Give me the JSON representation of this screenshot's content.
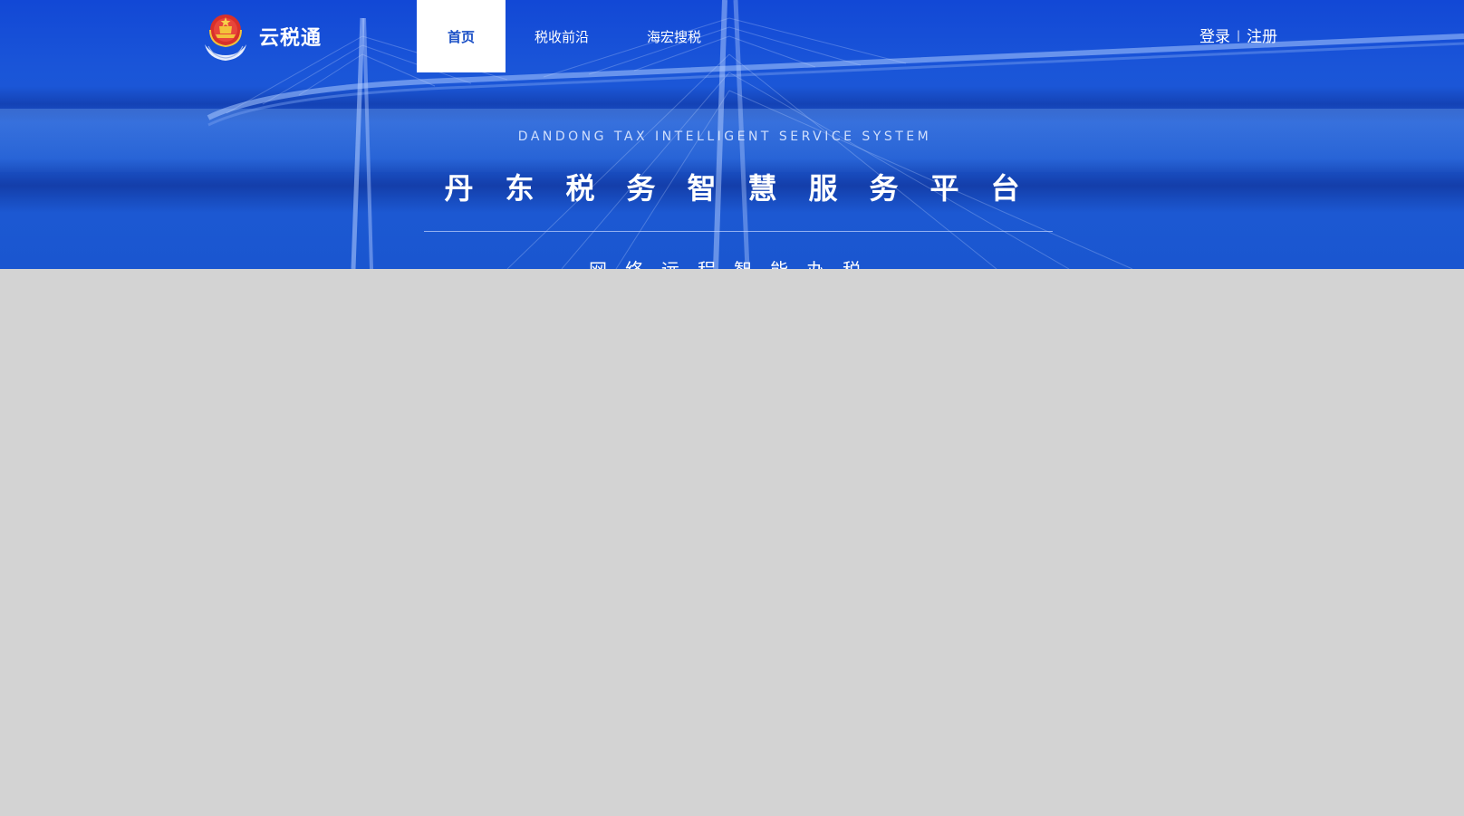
{
  "logo": {
    "brand": "云税通"
  },
  "nav": {
    "tabs": [
      {
        "label": "首页",
        "active": true
      },
      {
        "label": "税收前沿",
        "active": false
      },
      {
        "label": "海宏搜税",
        "active": false
      }
    ]
  },
  "auth": {
    "login": "登录",
    "separator": "|",
    "register": "注册"
  },
  "hero": {
    "en_title": "DANDONG TAX INTELLIGENT SERVICE SYSTEM",
    "cn_title": "丹东税务智慧服务平台",
    "sub_title": "网络远程智能办税"
  },
  "colors": {
    "hero_blue": "#1a55d8",
    "page_gray": "#d3d3d3",
    "active_tab_text": "#1a4fc6"
  }
}
